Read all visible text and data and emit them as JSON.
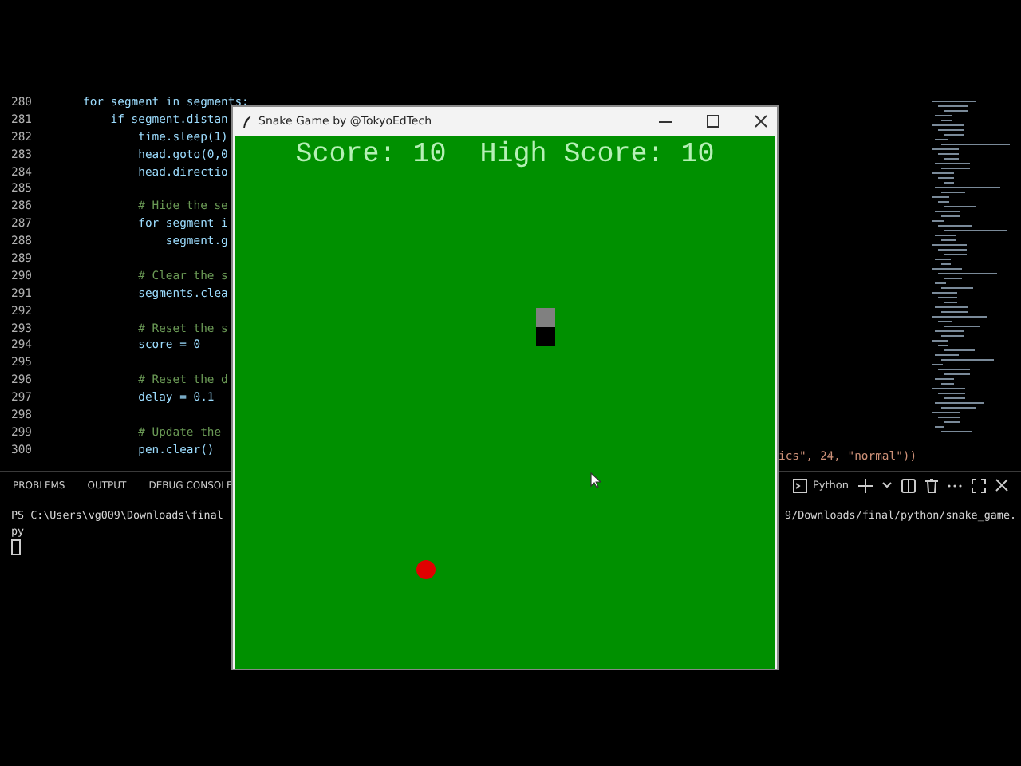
{
  "editor": {
    "lines": [
      {
        "number": "280",
        "code": "for segment in segments:"
      },
      {
        "number": "281",
        "code": "    if segment.distan"
      },
      {
        "number": "282",
        "code": "        time.sleep(1)"
      },
      {
        "number": "283",
        "code": "        head.goto(0,0"
      },
      {
        "number": "284",
        "code": "        head.directio"
      },
      {
        "number": "285"
      },
      {
        "number": "286",
        "code": "        # Hide the se"
      },
      {
        "number": "287",
        "code": "        for segment i"
      },
      {
        "number": "288",
        "code": "            segment.g"
      },
      {
        "number": "289"
      },
      {
        "number": "290",
        "code": "        # Clear the s"
      },
      {
        "number": "291",
        "code": "        segments.clea"
      },
      {
        "number": "292"
      },
      {
        "number": "293",
        "code": "        # Reset the s"
      },
      {
        "number": "294",
        "code": "        score = 0"
      },
      {
        "number": "295"
      },
      {
        "number": "296",
        "code": "        # Reset the d"
      },
      {
        "number": "297",
        "code": "        delay = 0.1"
      },
      {
        "number": "298"
      },
      {
        "number": "299",
        "code": "        # Update the"
      },
      {
        "number": "300",
        "code": "        pen.clear()"
      }
    ],
    "overflow_code": "ics\", 24, \"normal\"))"
  },
  "panel": {
    "tabs": [
      "PROBLEMS",
      "OUTPUT",
      "DEBUG CONSOLE"
    ],
    "terminal_profile": "Python",
    "terminal_left": [
      "PS C:\\Users\\vg009\\Downloads\\final",
      "py"
    ],
    "terminal_right": "9/Downloads/final/python/snake_game."
  },
  "game_window": {
    "title": "Snake Game by @TokyoEdTech",
    "score_text": "Score: 10  High Score: 10"
  }
}
